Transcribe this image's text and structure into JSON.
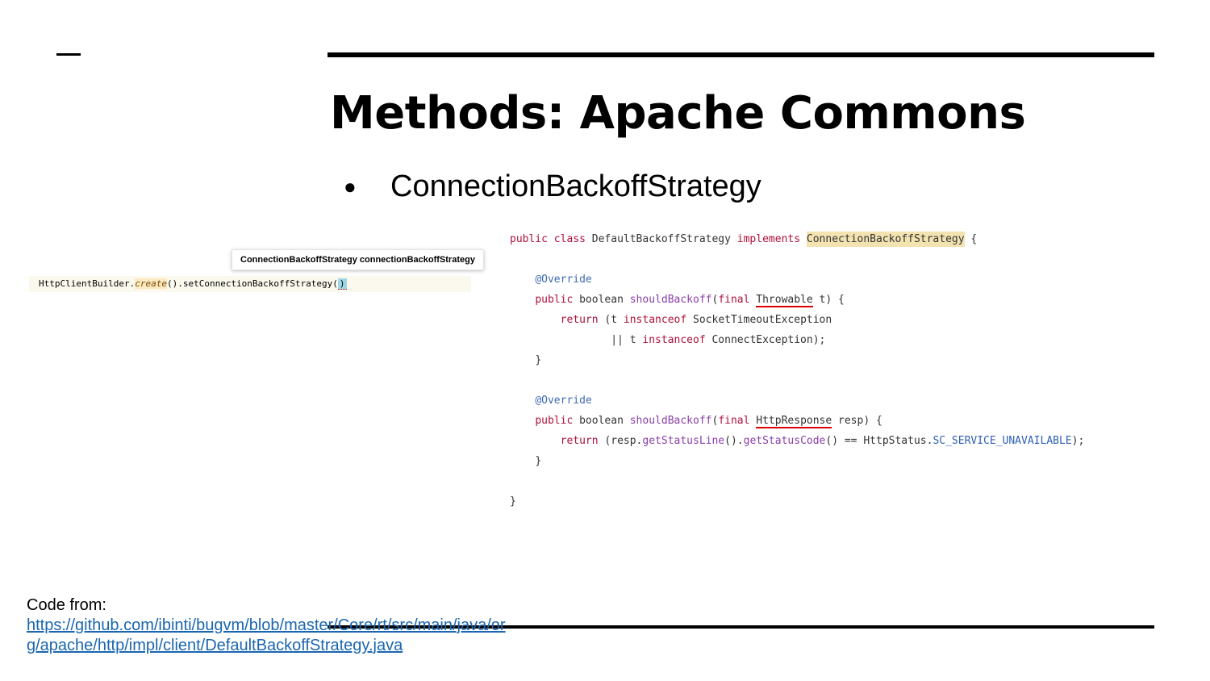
{
  "slide": {
    "title": "Methods: Apache Commons",
    "bullets": [
      {
        "marker": "●",
        "text": "ConnectionBackoffStrategy"
      }
    ]
  },
  "ide_snippet": {
    "tooltip": "ConnectionBackoffStrategy connectionBackoffStrategy",
    "code_prefix": "HttpClientBuilder.",
    "code_create": "create",
    "code_suffix": "().setConnectionBackoffStrategy(",
    "code_caret": ")"
  },
  "code_listing": {
    "l1_kw1": "public",
    "l1_kw2": "class",
    "l1_name": "DefaultBackoffStrategy",
    "l1_kw3": "implements",
    "l1_iface": "ConnectionBackoffStrategy",
    "l1_brace": "{",
    "annotation": "@Override",
    "kw_public": "public",
    "kw_boolean": "boolean",
    "method": "shouldBackoff",
    "kw_final": "final",
    "m1_type": "Throwable",
    "m1_param": "t) {",
    "kw_return": "return",
    "m1_ret1": "(t",
    "kw_instanceof": "instanceof",
    "m1_ret1_type": "SocketTimeoutException",
    "m1_ret2_or": "|| t",
    "m1_ret2_type": "ConnectException);",
    "close_brace": "}",
    "m2_type": "HttpResponse",
    "m2_param": "resp) {",
    "m2_ret_a": "(resp.",
    "m2_getStatusLine": "getStatusLine",
    "m2_ret_b": "().",
    "m2_getStatusCode": "getStatusCode",
    "m2_ret_c": "() == HttpStatus.",
    "m2_const": "SC_SERVICE_UNAVAILABLE",
    "m2_ret_d": ");"
  },
  "footer": {
    "label": "Code from:",
    "link": "https://github.com/ibinti/bugvm/blob/master/Core/rt/src/main/java/org/apache/http/impl/client/DefaultBackoffStrategy.java"
  },
  "colors": {
    "keyword": "#b0103b",
    "annotation": "#3e6bb0",
    "method": "#8a3ea8",
    "link": "#1a66b0",
    "highlight": "#f3e3b0"
  }
}
